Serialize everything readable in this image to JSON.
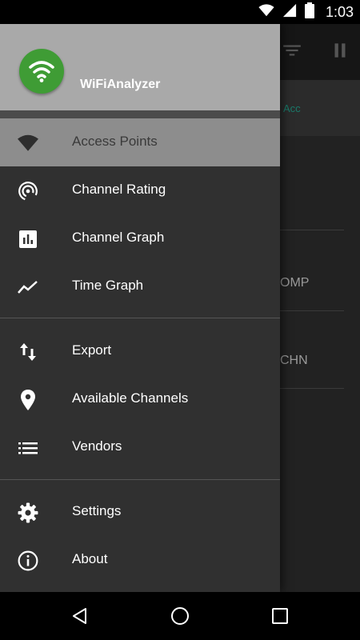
{
  "status_bar": {
    "time": "1:03",
    "icons": [
      "wifi-icon",
      "signal-icon",
      "battery-icon"
    ]
  },
  "background_app": {
    "band_text": "Acc",
    "rows": [
      "OMP",
      "CHN"
    ],
    "toolbar_icons": [
      "filter-icon",
      "pause-icon"
    ]
  },
  "drawer": {
    "app_name": "WiFiAnalyzer",
    "logo_color": "#3f9c35",
    "groups": [
      {
        "items": [
          {
            "label": "Access Points",
            "icon": "wifi-icon",
            "selected": true
          },
          {
            "label": "Channel Rating",
            "icon": "signal-rating-icon",
            "selected": false
          },
          {
            "label": "Channel Graph",
            "icon": "bar-chart-icon",
            "selected": false
          },
          {
            "label": "Time Graph",
            "icon": "line-chart-icon",
            "selected": false
          }
        ]
      },
      {
        "items": [
          {
            "label": "Export",
            "icon": "swap-vert-icon",
            "selected": false
          },
          {
            "label": "Available Channels",
            "icon": "location-pin-icon",
            "selected": false
          },
          {
            "label": "Vendors",
            "icon": "list-icon",
            "selected": false
          }
        ]
      },
      {
        "items": [
          {
            "label": "Settings",
            "icon": "gear-icon",
            "selected": false
          },
          {
            "label": "About",
            "icon": "info-icon",
            "selected": false
          }
        ]
      }
    ]
  },
  "nav_bar": {
    "buttons": [
      "back-icon",
      "home-icon",
      "recents-icon"
    ]
  }
}
